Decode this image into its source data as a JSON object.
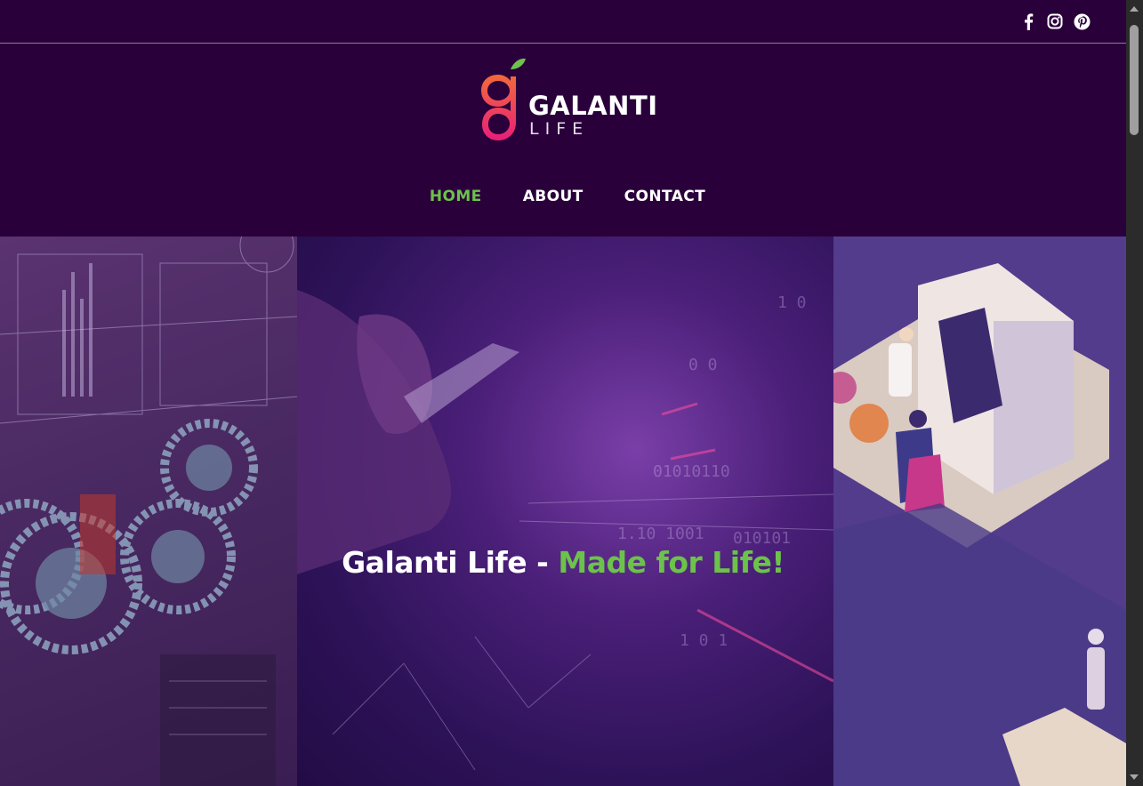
{
  "social": {
    "icons": [
      "facebook-icon",
      "instagram-icon",
      "pinterest-icon"
    ]
  },
  "logo": {
    "title": "GALANTI",
    "subtitle": "LIFE"
  },
  "nav": {
    "items": [
      {
        "label": "HOME",
        "active": true
      },
      {
        "label": "ABOUT",
        "active": false
      },
      {
        "label": "CONTACT",
        "active": false
      }
    ]
  },
  "hero": {
    "title_main": "Galanti Life - ",
    "title_accent": "Made for Life!"
  },
  "colors": {
    "background": "#2a003b",
    "accent_green": "#6cc24a",
    "logo_gradient_start": "#f26a3a",
    "logo_gradient_end": "#e91e7a"
  }
}
